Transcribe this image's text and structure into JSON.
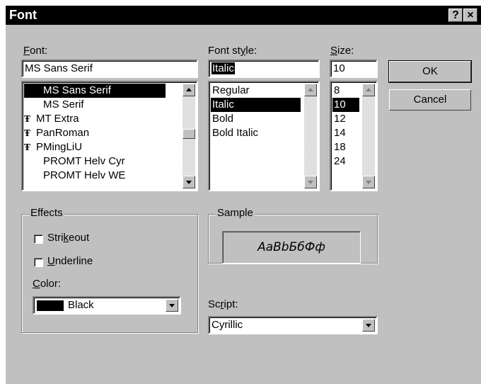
{
  "window": {
    "title": "Font",
    "help_label": "?",
    "close_label": "×"
  },
  "font": {
    "label": "Font:",
    "label_hot": "F",
    "label_rest": "ont:",
    "value": "MS Sans Serif",
    "items": [
      {
        "label": "MS Sans Serif",
        "tt": "",
        "selected": true
      },
      {
        "label": "MS Serif",
        "tt": ""
      },
      {
        "label": "MT Extra",
        "tt": "Ŧ"
      },
      {
        "label": "PanRoman",
        "tt": "Ŧ"
      },
      {
        "label": "PMingLiU",
        "tt": "Ŧ"
      },
      {
        "label": "PROMT Helv Cyr",
        "tt": ""
      },
      {
        "label": "PROMT Helv WE",
        "tt": ""
      }
    ]
  },
  "style": {
    "label_pre": "Font st",
    "label_hot": "y",
    "label_post": "le:",
    "value": "Italic",
    "items": [
      {
        "label": "Regular"
      },
      {
        "label": "Italic",
        "selected": true
      },
      {
        "label": "Bold"
      },
      {
        "label": "Bold Italic"
      }
    ]
  },
  "size": {
    "label_hot": "S",
    "label_rest": "ize:",
    "value": "10",
    "items": [
      "8",
      "10",
      "12",
      "14",
      "18",
      "24"
    ],
    "selected_index": 1
  },
  "buttons": {
    "ok": "OK",
    "cancel": "Cancel"
  },
  "effects": {
    "title": "Effects",
    "strikeout_pre": "Stri",
    "strikeout_hot": "k",
    "strikeout_post": "eout",
    "underline_hot": "U",
    "underline_rest": "nderline",
    "color_hot": "C",
    "color_rest": "olor:",
    "color_value": "Black",
    "color_hex": "#000000"
  },
  "sample": {
    "title": "Sample",
    "text": "AaBbБбФф"
  },
  "script": {
    "label_pre": "Sc",
    "label_hot": "r",
    "label_post": "ipt:",
    "value": "Cyrillic"
  }
}
